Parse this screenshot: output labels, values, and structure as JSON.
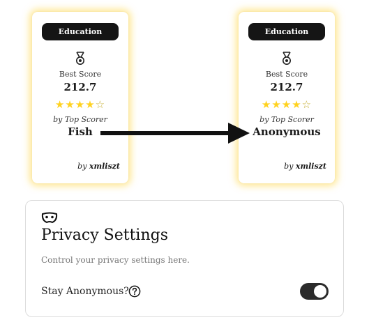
{
  "cards": [
    {
      "badge": "Education",
      "best_label": "Best Score",
      "score": "212.7",
      "rating": 4,
      "rating_max": 5,
      "scorer_label": "by Top Scorer",
      "scorer_name": "Fish",
      "author_prefix": "by",
      "author": "xmliszt"
    },
    {
      "badge": "Education",
      "best_label": "Best Score",
      "score": "212.7",
      "rating": 4,
      "rating_max": 5,
      "scorer_label": "by Top Scorer",
      "scorer_name": "Anonymous",
      "author_prefix": "by",
      "author": "xmliszt"
    }
  ],
  "privacy": {
    "icon": "mask-icon",
    "title": "Privacy Settings",
    "description": "Control your privacy settings here.",
    "toggle_label": "Stay Anonymous?",
    "help_icon": "question-circle-icon",
    "toggle_on": true
  },
  "colors": {
    "star": "#ffd21f",
    "glow": "#ffd640",
    "badge_bg": "#151515",
    "toggle_on": "#2b2b2b"
  }
}
